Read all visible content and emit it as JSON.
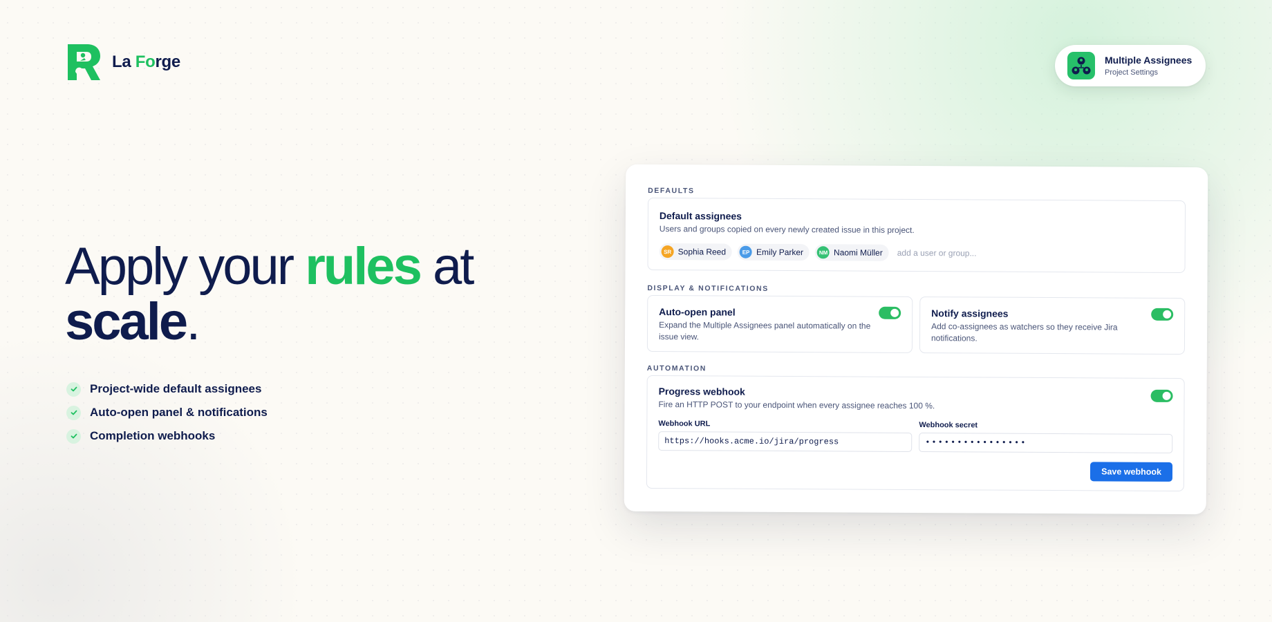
{
  "brand": {
    "name_prefix": "La ",
    "name_accent": "Fo",
    "name_suffix": "rge"
  },
  "app_badge": {
    "title": "Multiple Assignees",
    "subtitle": "Project Settings"
  },
  "hero": {
    "line1_pre": "Apply your ",
    "line1_accent": "rules",
    "line1_post": " at",
    "line2_bold": "scale",
    "line2_post": "."
  },
  "features": [
    "Project-wide default assignees",
    "Auto-open panel & notifications",
    "Completion webhooks"
  ],
  "settings": {
    "defaults": {
      "section_title": "DEFAULTS",
      "title": "Default assignees",
      "description": "Users and groups copied on every newly created issue in this project.",
      "assignees": [
        {
          "initials": "SR",
          "name": "Sophia Reed",
          "color": "#f5a524"
        },
        {
          "initials": "EP",
          "name": "Emily Parker",
          "color": "#4a9be8"
        },
        {
          "initials": "NM",
          "name": "Naomi Müller",
          "color": "#35c174"
        }
      ],
      "add_placeholder": "add a user or group..."
    },
    "display": {
      "section_title": "DISPLAY & NOTIFICATIONS",
      "auto_open": {
        "title": "Auto-open panel",
        "description": "Expand the Multiple Assignees panel automatically on the issue view.",
        "enabled": true
      },
      "notify": {
        "title": "Notify assignees",
        "description": "Add co-assignees as watchers so they receive Jira notifications.",
        "enabled": true
      }
    },
    "automation": {
      "section_title": "AUTOMATION",
      "title": "Progress webhook",
      "description": "Fire an HTTP POST to your endpoint when every assignee reaches 100 %.",
      "enabled": true,
      "url_label": "Webhook URL",
      "url_value": "https://hooks.acme.io/jira/progress",
      "secret_label": "Webhook secret",
      "secret_value": "••••••••••••••••",
      "save_label": "Save webhook"
    }
  },
  "colors": {
    "accent_green": "#1ec060",
    "navy": "#0f1c4d",
    "button_blue": "#1b6fe8",
    "toggle_green": "#2bbd63"
  }
}
